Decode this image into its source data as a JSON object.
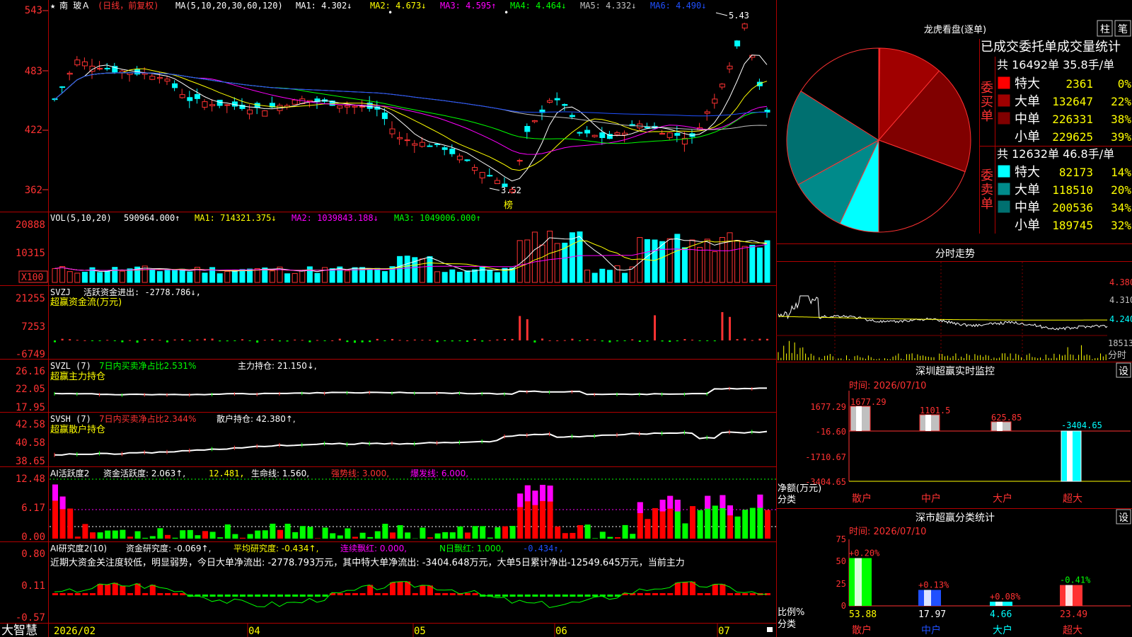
{
  "chart_header": {
    "star": "★",
    "stock_name": "南 玻Ａ",
    "period_label": "(日线，前复权)",
    "ma_label": "MA(5,10,20,30,60,120)",
    "ma1": "MA1: 4.302↓",
    "ma2": "MA2: 4.673↓",
    "ma3": "MA3: 4.595↑",
    "ma4": "MA4: 4.464↓",
    "ma5": "MA5: 4.332↓",
    "ma6": "MA6: 4.490↓",
    "high_label": "5.43",
    "low_label": "3.62",
    "bang_label": "榜"
  },
  "price_axis": [
    "543",
    "483",
    "422",
    "362"
  ],
  "vol_header": {
    "name": "VOL(5,10,20)",
    "vol": "590964.000↑",
    "ma1": "MA1: 714321.375↓",
    "ma2": "MA2: 1039843.188↓",
    "ma3": "MA3: 1049006.000↑"
  },
  "vol_axis": [
    "20888",
    "10315"
  ],
  "vol_unit": "X100",
  "svzj_header": {
    "name": "SVZJ",
    "desc": "活跃资金进出: -2778.786↓,",
    "subtitle": "超赢资金流(万元)"
  },
  "svzj_axis": [
    "21255",
    "7253",
    "-6749"
  ],
  "svzl_header": {
    "name": "SVZL (7)",
    "desc": "7日内买卖净占比2.531%",
    "hold": "主力持仓: 21.150↓,",
    "subtitle": "超赢主力持仓"
  },
  "svzl_axis": [
    "26.16",
    "22.05",
    "17.95"
  ],
  "svsh_header": {
    "name": "SVSH (7)",
    "desc": "7日内买卖净占比2.344%",
    "hold": "散户持仓: 42.380↑,",
    "subtitle": "超赢散户持仓"
  },
  "svsh_axis": [
    "42.58",
    "40.58",
    "38.65"
  ],
  "ai1_header": {
    "name": "AI活跃度2",
    "activity": "资金活跃度: 2.063↑,",
    "v2": "12.481,",
    "life": "生命线: 1.560,",
    "strong": "强势线: 3.000,",
    "burst": "爆发线: 6.000,"
  },
  "ai1_axis": [
    "12.48",
    "6.17",
    "0.00"
  ],
  "ai2_header": {
    "name": "AI研究度2(10)",
    "research": "资金研究度: -0.069↑,",
    "avg": "平均研究度: -0.434↑,",
    "streak": "连续飘红: 0.000,",
    "nday": "N日飘红: 1.000,",
    "tail": "-0.434↑,"
  },
  "ai2_comment": "近期大资金关注度较低，明显弱势，今日大单净流出: -2778.793万元，其中特大单净流出: -3404.648万元，大单5日累计净出-12549.645万元，当前主力",
  "ai2_axis": [
    "0.80",
    "0.11",
    "-0.57"
  ],
  "date_axis": [
    "2026/02",
    "04",
    "05",
    "06",
    "07"
  ],
  "app_logo": "大智慧",
  "lhb": {
    "title": "龙虎看盘(逐单)",
    "btn_zhu": "柱",
    "btn_bi": "笔",
    "subtitle": "已成交委托单成交量统计",
    "buy_total": "共 16492单 35.8手/单",
    "buy_label": "委买单",
    "sell_total": "共 12632单 46.8手/单",
    "sell_label": "委卖单",
    "buy_rows": [
      {
        "name": "特大",
        "value": "2361",
        "pct": "0%",
        "color": "#ff0000"
      },
      {
        "name": "大单",
        "value": "132647",
        "pct": "22%",
        "color": "#a00000"
      },
      {
        "name": "中单",
        "value": "226331",
        "pct": "38%",
        "color": "#800000"
      },
      {
        "name": "小单",
        "value": "229625",
        "pct": "39%",
        "color": "#000000"
      }
    ],
    "sell_rows": [
      {
        "name": "特大",
        "value": "82173",
        "pct": "14%",
        "color": "#00ffff"
      },
      {
        "name": "大单",
        "value": "118510",
        "pct": "20%",
        "color": "#008a8a"
      },
      {
        "name": "中单",
        "value": "200536",
        "pct": "34%",
        "color": "#007070"
      },
      {
        "name": "小单",
        "value": "189745",
        "pct": "32%",
        "color": "#000000"
      }
    ]
  },
  "intraday": {
    "title": "分时走势",
    "axis": [
      "4.380",
      "4.310",
      "4.240"
    ],
    "vol_axis": "18513",
    "vol_unit": "分时"
  },
  "sz_monitor": {
    "title": "深圳超赢实时监控",
    "settings": "设",
    "time_label": "时间: 2026/07/10",
    "axis": [
      "1677.29",
      "-16.60",
      "-1710.67",
      "-3404.65"
    ],
    "axis_label1": "净额(万元)",
    "axis_label2": "分类",
    "categories": [
      "散户",
      "中户",
      "大户",
      "超大"
    ],
    "values": [
      1677.29,
      1101.5,
      625.85,
      -3404.65
    ],
    "value_labels": [
      "1677.29",
      "1101.5",
      "625.85",
      "-3404.65"
    ]
  },
  "sz_class": {
    "title": "深市超赢分类统计",
    "settings": "设",
    "time_label": "时间: 2026/07/10",
    "axis": [
      "75",
      "50",
      "25",
      "0"
    ],
    "axis_label1": "比例%",
    "axis_label2": "分类",
    "categories": [
      "散户",
      "中户",
      "大户",
      "超大"
    ],
    "values": [
      53.88,
      17.97,
      4.66,
      23.49
    ],
    "value_labels": [
      "53.88",
      "17.97",
      "4.66",
      "23.49"
    ],
    "changes": [
      "+0.20%",
      "+0.13%",
      "+0.08%",
      "-0.41%"
    ]
  },
  "colors": {
    "up": "#ff3232",
    "down": "#00ffff",
    "green": "#00ff00",
    "yellow": "#ffff00",
    "magenta": "#ff00ff",
    "grid": "#a00000",
    "axis_text": "#ff3232"
  }
}
